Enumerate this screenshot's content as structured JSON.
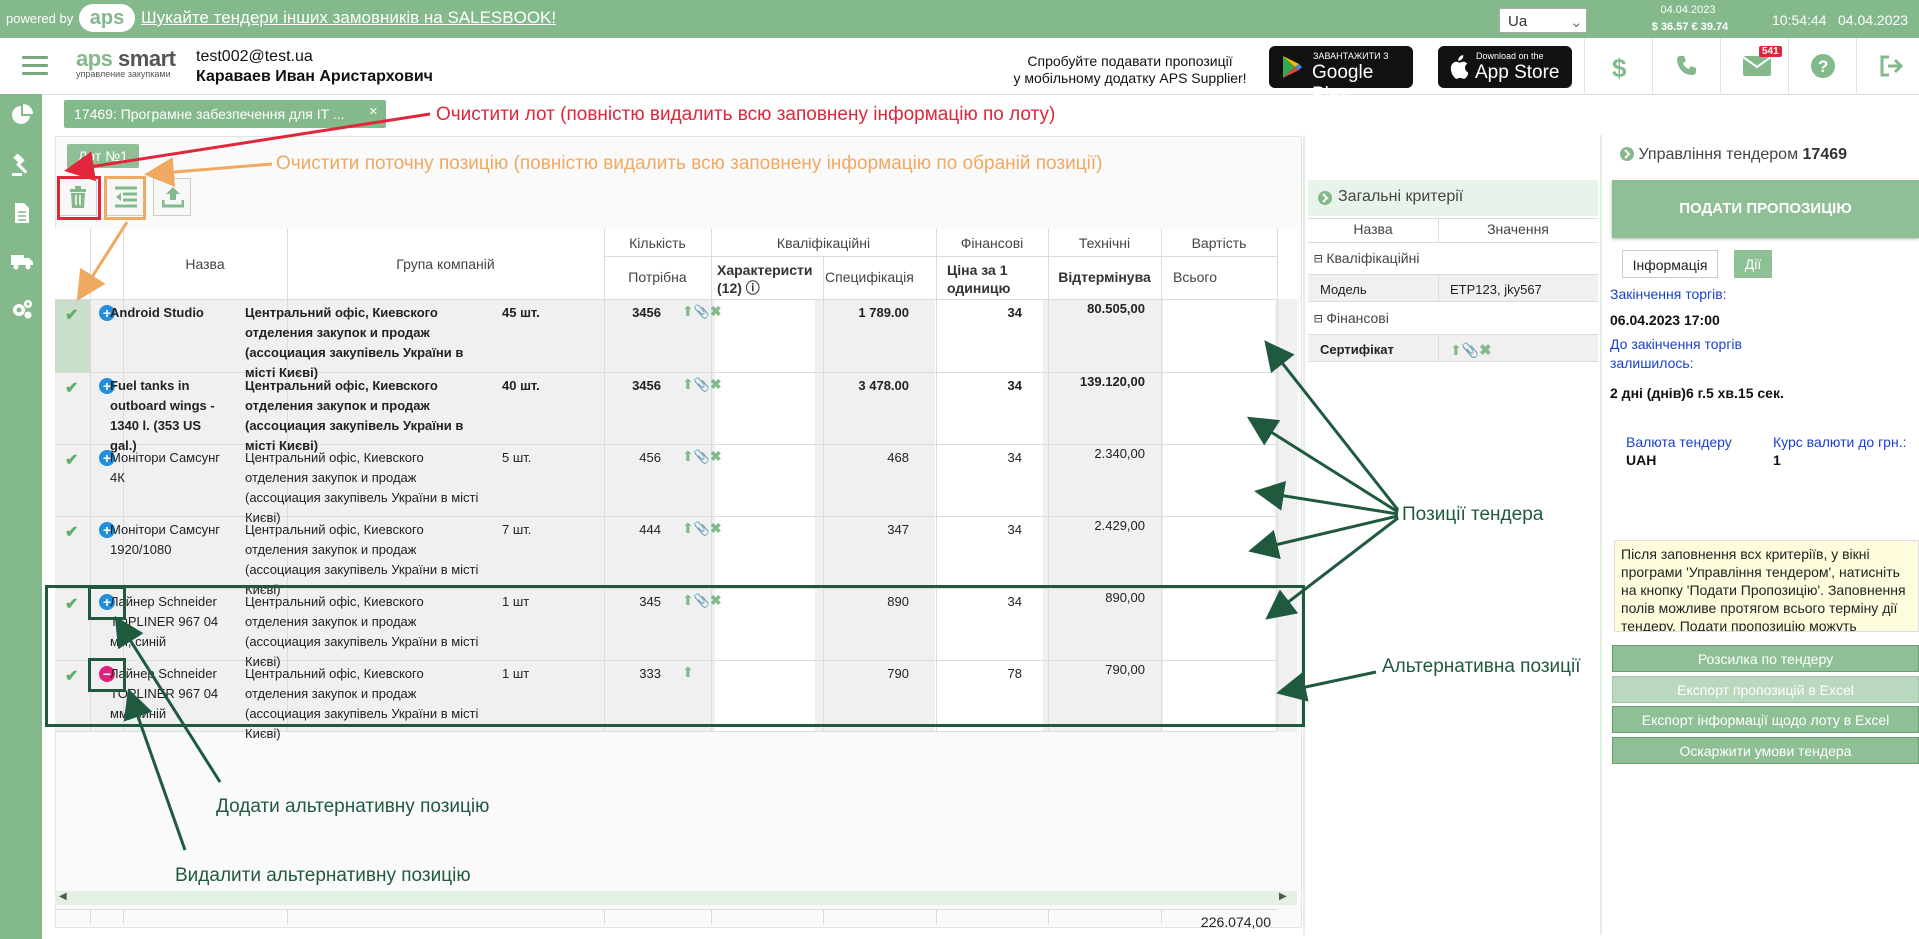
{
  "topbar": {
    "powered_by": "powered by",
    "aps_logo": "aps",
    "promo_link": "Шукайте тендери інших замовників на SALESBOOK!",
    "language": "Ua",
    "rates_date": "04.04.2023",
    "rates": "$ 36.57  € 39.74",
    "time": "10:54:44",
    "date": "04.04.2023"
  },
  "header": {
    "brand_main_a": "aps",
    "brand_main_b": " smart",
    "brand_sub": "управление закупками",
    "user_email": "test002@test.ua",
    "user_name": "Караваев Иван Аристархович",
    "mobile_promo_1": "Спробуйте подавати пропозиції",
    "mobile_promo_2": "у мобільному додатку APS Supplier!",
    "google_small": "ЗАВАНТАЖИТИ З",
    "google_big": "Google Play",
    "apple_small": "Download on the",
    "apple_big": "App Store",
    "mail_badge": "541"
  },
  "lot_tab": {
    "label": "17469: Програмне забезпечення для IT ...",
    "close": "×"
  },
  "lot_button": "Лот №1",
  "table": {
    "headers": {
      "name": "Назва",
      "group": "Група компаній",
      "qty": "Кількість",
      "qty_sub": "Потрібна",
      "qual": "Кваліфікаційні",
      "qual_sub1": "Характеристи (12)",
      "qual_sub2": "Специфікація",
      "fin": "Фінансові",
      "fin_sub": "Ціна за 1 одиницю",
      "tech": "Технічні",
      "tech_sub": "Відтермінува",
      "cost": "Вартість",
      "cost_sub": "Всього"
    },
    "rows": [
      {
        "name": "Android Studio",
        "group": "Центральний офіс, Киевского отделения закупок и продаж (ассоциация закупівель України в місті Києві)",
        "qty": "45 шт.",
        "char": "3456",
        "price": "1 789.00",
        "delay": "34",
        "total": "80.505,00",
        "bold": true
      },
      {
        "name": "Fuel tanks in outboard wings - 1340 l. (353 US gal.)",
        "group": "Центральний офіс, Киевского отделения закупок и продаж (ассоциация закупівель України в місті Києві)",
        "qty": "40 шт.",
        "char": "3456",
        "price": "3 478.00",
        "delay": "34",
        "total": "139.120,00",
        "bold": true
      },
      {
        "name": "Монітори Самсунг 4К",
        "group": "Центральний офіс, Киевского отделения закупок и продаж (ассоциация закупівель України в місті Києві)",
        "qty": "5 шт.",
        "char": "456",
        "price": "468",
        "delay": "34",
        "total": "2.340,00",
        "bold": false
      },
      {
        "name": "Монітори Самсунг 1920/1080",
        "group": "Центральний офіс, Киевского отделения закупок и продаж (ассоциация закупівель України в місті Києві)",
        "qty": "7 шт.",
        "char": "444",
        "price": "347",
        "delay": "34",
        "total": "2.429,00",
        "bold": false
      },
      {
        "name": "Лайнер Schneider TOPLINER 967 04 мм, синій",
        "group": "Центральний офіс, Киевского отделения закупок и продаж (ассоциация закупівель України в місті Києві)",
        "qty": "1 шт",
        "char": "345",
        "price": "890",
        "delay": "34",
        "total": "890,00",
        "bold": false
      },
      {
        "name": "Лайнер Schneider TOPLINER 967 04 мм, синій",
        "group": "Центральний офіс, Киевского отделения закупок и продаж (ассоциация закупівель України в місті Києві)",
        "qty": "1 шт",
        "char": "333",
        "price": "790",
        "delay": "78",
        "total": "790,00",
        "bold": false
      }
    ],
    "grand_total": "226.074,00"
  },
  "annotations": {
    "clear_lot": "Очистити лот (повністю видалить всю заповнену інформацію по лоту)",
    "clear_position": "Очистити поточну позицію (повністю видалить всю заповнену інформацію по обраній позиції)",
    "positions": "Позиції тендера",
    "alternative": "Альтернативна позиції",
    "add_alt": "Додати альтернативну позицію",
    "del_alt": "Видалити альтернативну позицію"
  },
  "criteria": {
    "title": "Загальні критерії",
    "col_name": "Назва",
    "col_value": "Значення",
    "group_qual": "Кваліфікаційні",
    "model_label": "Модель",
    "model_value": "ETP123, jky567",
    "group_fin": "Фінансові",
    "cert_label": "Сертифікат"
  },
  "right_panel": {
    "title_prefix": "Управління тендером",
    "tender_no": "17469",
    "submit": "ПОДАТИ ПРОПОЗИЦІЮ",
    "tab_info": "Інформація",
    "tab_actions": "Дії",
    "end_label": "Закінчення торгів:",
    "end_value": "06.04.2023 17:00",
    "remaining_label": "До закінчення торгів залишилось:",
    "remaining_value": "2 дні (днів)6 г.5 хв.15 сек.",
    "currency_label": "Валюта тендеру",
    "currency_value": "UAH",
    "rate_label": "Курс валюти до грн.:",
    "rate_value": "1",
    "note": "Після заповнення всх критеріїв, у вікні програми 'Управління тендером', натисніть на кнопку 'Подати Пропозицію'. Заповнення полів можливе протягом всього терміну дії тендеру. Подати пропозицію можуть",
    "btn_mailing": "Розсилка по тендеру",
    "btn_export_offers": "Експорт пропозицій в Excel",
    "btn_export_lot": "Експорт інформації щодо лоту в Excel",
    "btn_appeal": "Оскаржити умови тендера"
  },
  "colors": {
    "brand_green": "#84b98c",
    "annotation_red": "#e1253a",
    "annotation_orange": "#efa960",
    "annotation_dark_green": "#1f5a3f"
  }
}
